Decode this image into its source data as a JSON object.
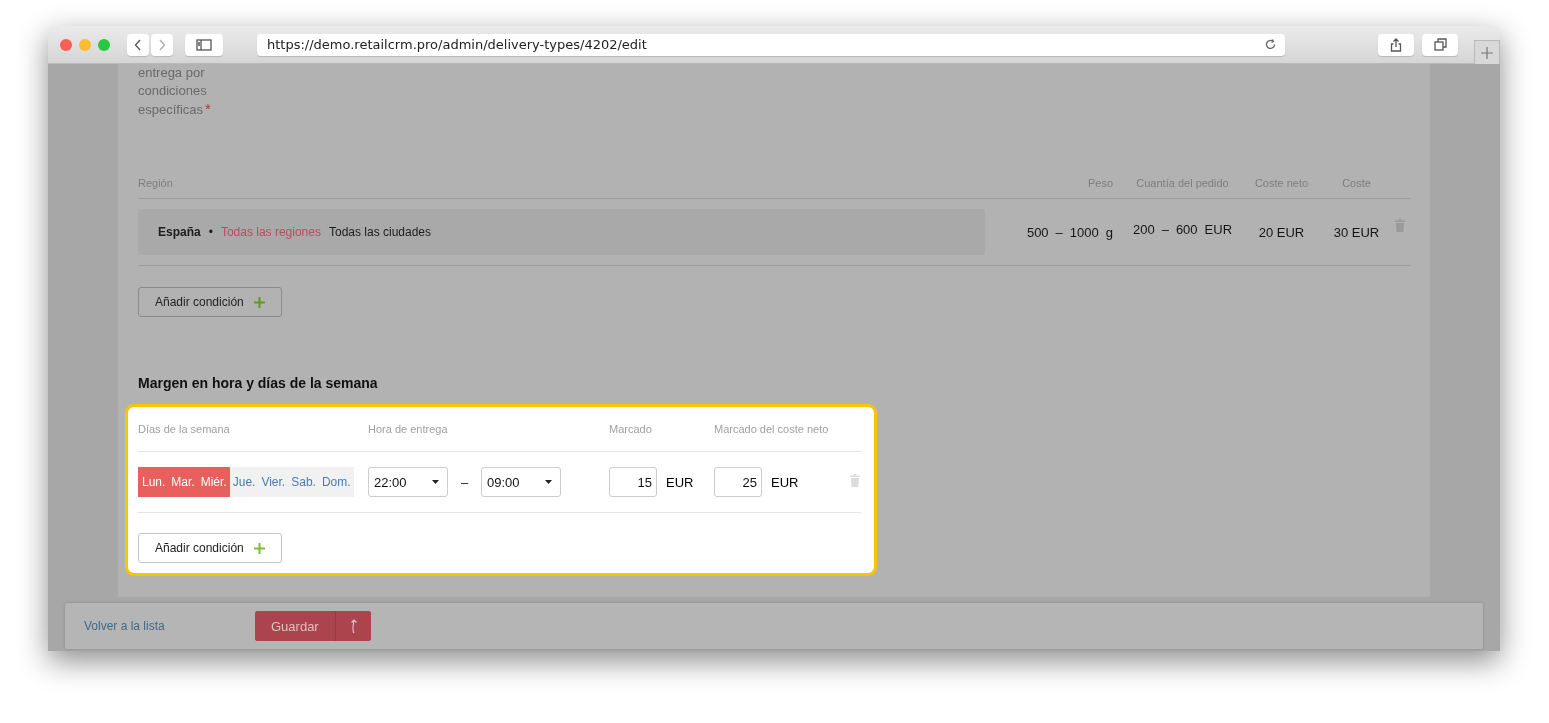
{
  "browser": {
    "url": "https://demo.retailcrm.pro/admin/delivery-types/4202/edit"
  },
  "conditions_field": {
    "label": "entrega por condiciones específicas",
    "required_mark": "*"
  },
  "regions_table": {
    "columns": [
      "Región",
      "Peso",
      "Cuantía del pedido",
      "Coste neto",
      "Coste"
    ],
    "rows": [
      {
        "country": "España",
        "bullet": "•",
        "region": "Todas las regiones",
        "city": "Todas las ciudades",
        "weight_from": "500",
        "weight_to": "1000",
        "weight_unit": "g",
        "amount_from": "200",
        "amount_to": "600",
        "amount_unit": "EUR",
        "range_separator": "–",
        "net_cost": "20 EUR",
        "cost": "30 EUR"
      }
    ],
    "add_button": "Añadir condición"
  },
  "margin_section": {
    "title": "Margen en hora y días de la semana",
    "highlighted": true,
    "columns": [
      "Días de la semana",
      "Hora de entrega",
      "Marcado",
      "Marcado del coste neto"
    ],
    "rows": [
      {
        "days": [
          {
            "label": "Lun.",
            "selected": true
          },
          {
            "label": "Mar.",
            "selected": true
          },
          {
            "label": "Miér.",
            "selected": true
          },
          {
            "label": "Jue.",
            "selected": false
          },
          {
            "label": "Vier.",
            "selected": false
          },
          {
            "label": "Sab.",
            "selected": false
          },
          {
            "label": "Dom.",
            "selected": false
          }
        ],
        "time_from": "22:00",
        "time_separator": "–",
        "time_to": "09:00",
        "markup": "15",
        "markup_unit": "EUR",
        "net_markup": "25",
        "net_markup_unit": "EUR"
      }
    ],
    "add_button": "Añadir condición"
  },
  "footer": {
    "back_link": "Volver a la lista",
    "save_button": "Guardar"
  }
}
